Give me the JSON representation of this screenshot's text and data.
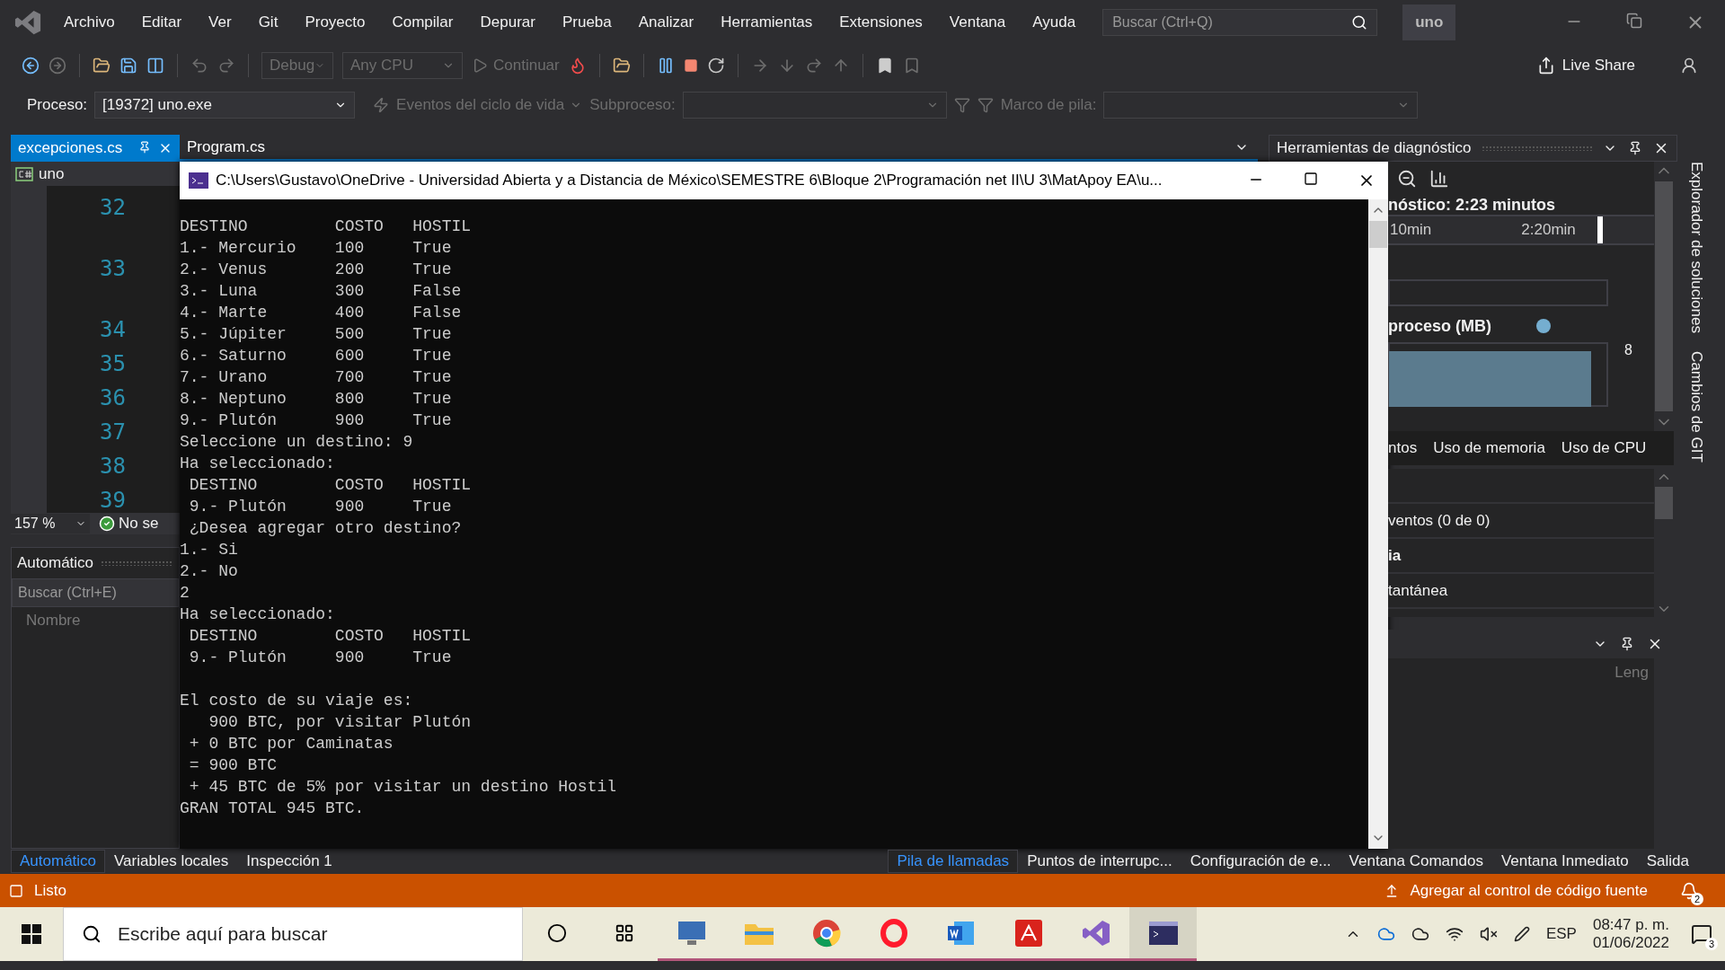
{
  "menu": {
    "items": [
      "Archivo",
      "Editar",
      "Ver",
      "Git",
      "Proyecto",
      "Compilar",
      "Depurar",
      "Prueba",
      "Analizar",
      "Herramientas",
      "Extensiones",
      "Ventana",
      "Ayuda"
    ],
    "search_placeholder": "Buscar (Ctrl+Q)",
    "solution": "uno"
  },
  "toolbar": {
    "configuration": "Debug",
    "platform": "Any CPU",
    "continue": "Continuar",
    "live_share": "Live Share"
  },
  "debug_bar": {
    "process_label": "Proceso:",
    "process": "[19372] uno.exe",
    "lifecycle": "Eventos del ciclo de vida",
    "thread_label": "Subproceso:",
    "stack_label": "Marco de pila:"
  },
  "editor": {
    "tabs": [
      {
        "label": "excepciones.cs",
        "selected": true
      },
      {
        "label": "Program.cs",
        "selected": false
      }
    ],
    "project": "uno",
    "line_numbers": [
      "32",
      "33",
      "34",
      "35",
      "36",
      "37",
      "38",
      "39"
    ],
    "zoom": "157 %",
    "status": "No se"
  },
  "autos_panel": {
    "title": "Automático",
    "search_placeholder": "Buscar (Ctrl+E)",
    "column": "Nombre"
  },
  "console": {
    "title": "C:\\Users\\Gustavo\\OneDrive - Universidad Abierta y a Distancia de México\\SEMESTRE 6\\Bloque 2\\Programación net II\\U 3\\MatApoy EA\\u...",
    "blocks": [
      [
        "DESTINO         COSTO   HOSTIL",
        "1.- Mercurio    100     True",
        "2.- Venus       200     True",
        "3.- Luna        300     False",
        "4.- Marte       400     False",
        "5.- Júpiter     500     True",
        "6.- Saturno     600     True",
        "7.- Urano       700     True",
        "8.- Neptuno     800     True",
        "9.- Plutón      900     True",
        "Seleccione un destino: 9",
        "Ha seleccionado:",
        " DESTINO        COSTO   HOSTIL",
        " 9.- Plutón     900     True",
        " ¿Desea agregar otro destino?",
        "1.- Si",
        "2.- No",
        "2",
        "Ha seleccionado:",
        " DESTINO        COSTO   HOSTIL",
        " 9.- Plutón     900     True"
      ],
      [
        "El costo de su viaje es:",
        "   900 BTC, por visitar Plutón",
        " + 0 BTC por Caminatas",
        " = 900 BTC",
        " + 45 BTC de 5% por visitar un destino Hostil",
        "GRAN TOTAL 945 BTC."
      ]
    ]
  },
  "diagnostics": {
    "title": "Herramientas de diagnóstico",
    "session": "nóstico: 2:23 minutos",
    "ticks": [
      "10min",
      "2:20min"
    ],
    "memory_title": "proceso (MB)",
    "memory_max": "8",
    "tabs": [
      "ntos",
      "Uso de memoria",
      "Uso de CPU"
    ],
    "rows": [
      {
        "kind": "item",
        "text": "ventos (0 de 0)"
      },
      {
        "kind": "heading",
        "text": "ia"
      },
      {
        "kind": "item",
        "text": "tantánea"
      }
    ],
    "second_panel_column": "Leng"
  },
  "side_tabs": [
    "Explorador de soluciones",
    "Cambios de GIT"
  ],
  "bottom_tabs_left": [
    {
      "label": "Automático",
      "selected": true
    },
    {
      "label": "Variables locales",
      "selected": false
    },
    {
      "label": "Inspección 1",
      "selected": false
    }
  ],
  "bottom_tabs_right": [
    {
      "label": "Pila de llamadas",
      "selected": true
    },
    {
      "label": "Puntos de interrupc...",
      "selected": false
    },
    {
      "label": "Configuración de e...",
      "selected": false
    },
    {
      "label": "Ventana Comandos",
      "selected": false
    },
    {
      "label": "Ventana Inmediato",
      "selected": false
    },
    {
      "label": "Salida",
      "selected": false
    }
  ],
  "status_bar": {
    "text": "Listo",
    "source_control": "Agregar al control de código fuente",
    "notifications": "2"
  },
  "taskbar": {
    "search_placeholder": "Escribe aquí para buscar",
    "apps": [
      {
        "kind": "monitor",
        "running": true,
        "active": false
      },
      {
        "kind": "folder",
        "running": true,
        "active": false
      },
      {
        "kind": "chrome",
        "running": true,
        "active": false
      },
      {
        "kind": "opera",
        "running": true,
        "active": false
      },
      {
        "kind": "word",
        "running": true,
        "active": false
      },
      {
        "kind": "acrobat",
        "running": true,
        "active": false
      },
      {
        "kind": "studio",
        "running": true,
        "active": false
      },
      {
        "kind": "terminal",
        "running": true,
        "active": true
      }
    ],
    "language": "ESP",
    "time": "08:47 p. m.",
    "date": "01/06/2022",
    "notifications": "3"
  }
}
